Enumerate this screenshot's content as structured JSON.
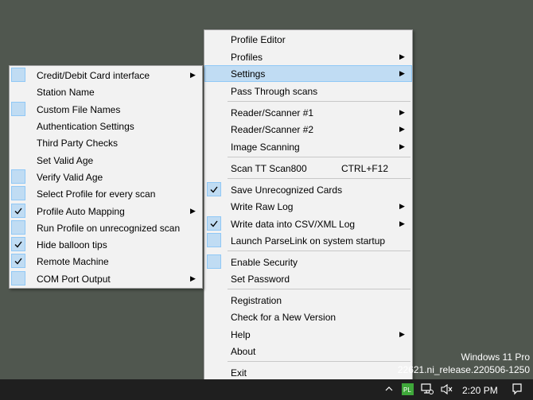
{
  "main_menu": {
    "items": [
      {
        "label": "Profile Editor"
      },
      {
        "label": "Profiles"
      },
      {
        "label": "Settings"
      },
      {
        "label": "Pass Through scans"
      },
      {
        "label": "Reader/Scanner #1"
      },
      {
        "label": "Reader/Scanner #2"
      },
      {
        "label": "Image Scanning"
      },
      {
        "label": "Scan TT Scan800",
        "shortcut": "CTRL+F12"
      },
      {
        "label": "Save Unrecognized Cards"
      },
      {
        "label": "Write Raw Log"
      },
      {
        "label": "Write data into CSV/XML Log"
      },
      {
        "label": "Launch ParseLink on system startup"
      },
      {
        "label": "Enable Security"
      },
      {
        "label": "Set Password"
      },
      {
        "label": "Registration"
      },
      {
        "label": "Check for a New Version"
      },
      {
        "label": "Help"
      },
      {
        "label": "About"
      },
      {
        "label": "Exit"
      }
    ]
  },
  "settings_submenu": {
    "items": [
      {
        "label": "Credit/Debit Card interface"
      },
      {
        "label": "Station Name"
      },
      {
        "label": "Custom File Names"
      },
      {
        "label": "Authentication Settings"
      },
      {
        "label": "Third Party Checks"
      },
      {
        "label": "Set Valid Age"
      },
      {
        "label": "Verify Valid Age"
      },
      {
        "label": "Select Profile for every scan"
      },
      {
        "label": "Profile Auto Mapping"
      },
      {
        "label": "Run Profile on unrecognized scan"
      },
      {
        "label": "Hide balloon tips"
      },
      {
        "label": "Remote Machine"
      },
      {
        "label": "COM Port Output"
      }
    ]
  },
  "watermark": {
    "line1": "Windows 11 Pro",
    "line2": "22621.ni_release.220506-1250"
  },
  "taskbar": {
    "time": "2:20 PM",
    "icons": [
      "chevron-up-icon",
      "parselink-tray-icon",
      "network-icon",
      "volume-muted-icon",
      "notification-icon"
    ]
  },
  "colors": {
    "desktop": "#50574f",
    "menu_bg": "#f2f2f2",
    "highlight": "#c0dcf3",
    "highlight_border": "#90c8f6",
    "taskbar": "#1f1f1f",
    "tray_app": "#3fa83a"
  }
}
